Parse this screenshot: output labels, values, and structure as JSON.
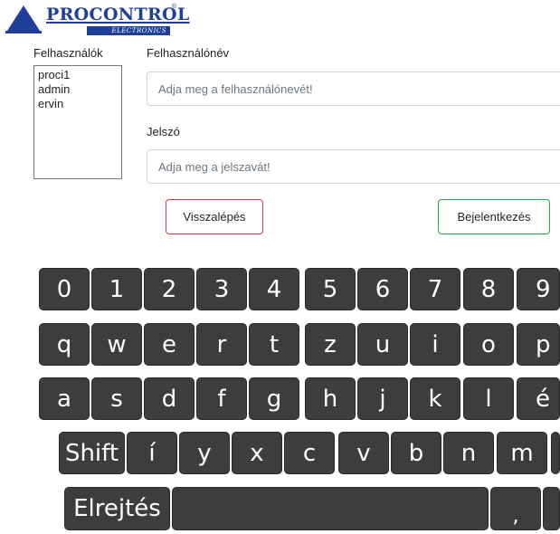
{
  "logo": {
    "name": "PROCONTROL",
    "sub": "ELECTRONICS",
    "mark": "®"
  },
  "users": {
    "label": "Felhasználók",
    "items": [
      "proci1",
      "admin",
      "ervin"
    ]
  },
  "form": {
    "username_label": "Felhasználónév",
    "username_placeholder": "Adja meg a felhasználónevét!",
    "password_label": "Jelszó",
    "password_placeholder": "Adja meg a jelszavát!"
  },
  "buttons": {
    "back": "Visszalépés",
    "login": "Bejelentkezés"
  },
  "keyboard": {
    "colors": {
      "key_bg": "#3d3d3d",
      "key_text": "#ffffff"
    },
    "row_digits": [
      "0",
      "1",
      "2",
      "3",
      "4",
      "5",
      "6",
      "7",
      "8",
      "9"
    ],
    "row_q": [
      "q",
      "w",
      "e",
      "r",
      "t",
      "z",
      "u",
      "i",
      "o",
      "p"
    ],
    "row_a": [
      "a",
      "s",
      "d",
      "f",
      "g",
      "h",
      "j",
      "k",
      "l",
      "é"
    ],
    "row_shift": [
      "Shift",
      "í",
      "y",
      "x",
      "c",
      "v",
      "b",
      "n",
      "m"
    ],
    "row_space": [
      "Elrejtés",
      "",
      ","
    ]
  }
}
